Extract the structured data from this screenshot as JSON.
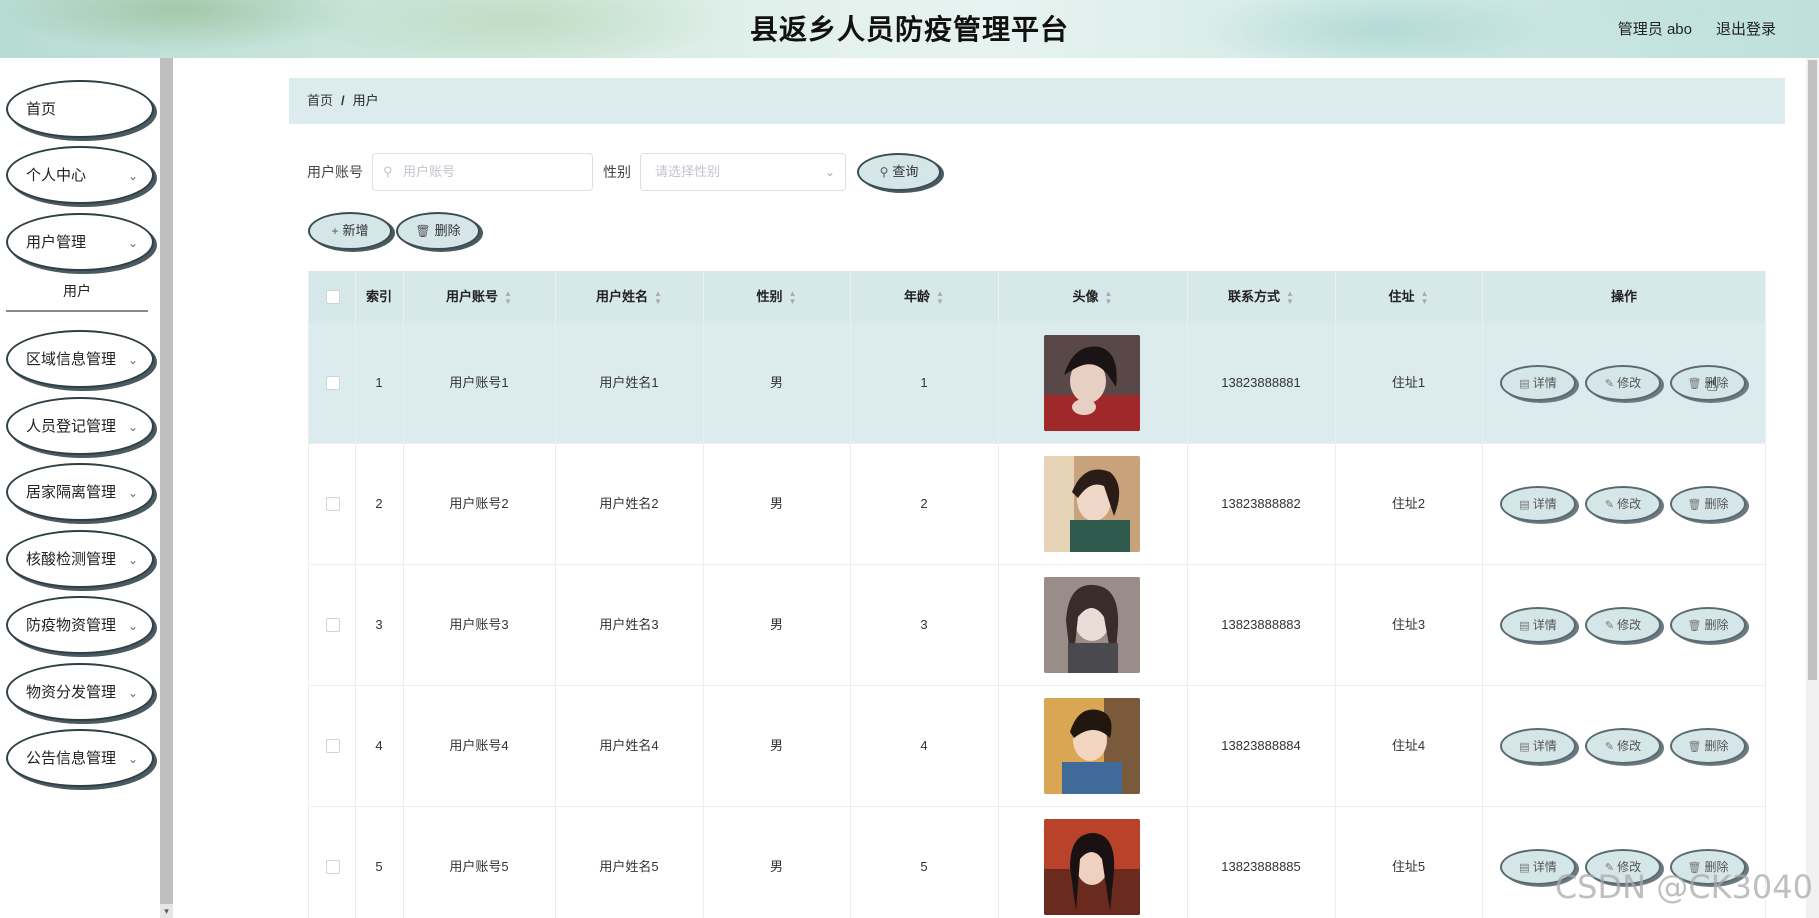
{
  "header": {
    "title": "县返乡人员防疫管理平台",
    "user_label": "管理员 abo",
    "logout_label": "退出登录"
  },
  "sidebar": {
    "items": [
      {
        "label": "首页",
        "has_children": false
      },
      {
        "label": "个人中心",
        "has_children": true
      },
      {
        "label": "用户管理",
        "has_children": true
      },
      {
        "label": "区域信息管理",
        "has_children": true
      },
      {
        "label": "人员登记管理",
        "has_children": true
      },
      {
        "label": "居家隔离管理",
        "has_children": true
      },
      {
        "label": "核酸检测管理",
        "has_children": true
      },
      {
        "label": "防疫物资管理",
        "has_children": true
      },
      {
        "label": "物资分发管理",
        "has_children": true
      },
      {
        "label": "公告信息管理",
        "has_children": true
      }
    ],
    "subitem": "用户"
  },
  "breadcrumb": {
    "home": "首页",
    "sep": "/",
    "current": "用户"
  },
  "search": {
    "account_label": "用户账号",
    "account_placeholder": "用户账号",
    "gender_label": "性别",
    "gender_placeholder": "请选择性别",
    "query_label": "查询"
  },
  "actions": {
    "add_label": "新增",
    "delete_label": "删除"
  },
  "table": {
    "columns": [
      "索引",
      "用户账号",
      "用户姓名",
      "性别",
      "年龄",
      "头像",
      "联系方式",
      "住址",
      "操作"
    ],
    "rows": [
      {
        "index": "1",
        "account": "用户账号1",
        "name": "用户姓名1",
        "gender": "男",
        "age": "1",
        "phone": "13823888881",
        "address": "住址1"
      },
      {
        "index": "2",
        "account": "用户账号2",
        "name": "用户姓名2",
        "gender": "男",
        "age": "2",
        "phone": "13823888882",
        "address": "住址2"
      },
      {
        "index": "3",
        "account": "用户账号3",
        "name": "用户姓名3",
        "gender": "男",
        "age": "3",
        "phone": "13823888883",
        "address": "住址3"
      },
      {
        "index": "4",
        "account": "用户账号4",
        "name": "用户姓名4",
        "gender": "男",
        "age": "4",
        "phone": "13823888884",
        "address": "住址4"
      },
      {
        "index": "5",
        "account": "用户账号5",
        "name": "用户姓名5",
        "gender": "男",
        "age": "5",
        "phone": "13823888885",
        "address": "住址5"
      }
    ],
    "row_actions": {
      "detail": "详情",
      "edit": "修改",
      "delete": "删除"
    }
  },
  "watermark": "CSDN @CK3040",
  "colors": {
    "accent_bg": "#d6e8ea",
    "outline": "#2f3f46"
  }
}
